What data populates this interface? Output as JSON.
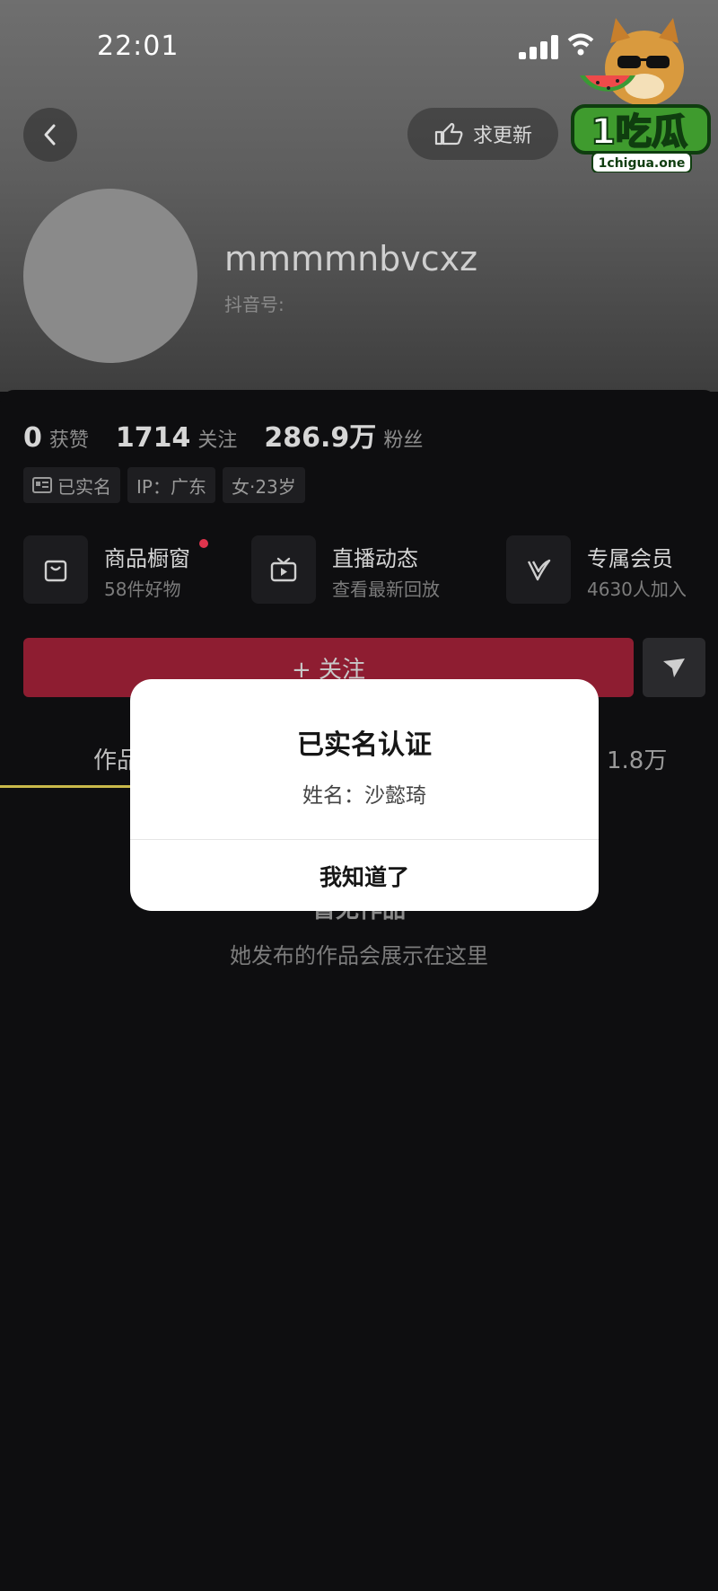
{
  "status_bar": {
    "time": "22:01"
  },
  "header": {
    "request_update_label": "求更新"
  },
  "profile": {
    "username": "mmmmnbvcxz",
    "douyin_id_label": "抖音号:",
    "stats": [
      {
        "value": "0",
        "label": "获赞"
      },
      {
        "value": "1714",
        "label": "关注"
      },
      {
        "value": "286.9万",
        "label": "粉丝"
      }
    ],
    "tags": [
      {
        "icon": "id-card-icon",
        "text": "已实名"
      },
      {
        "icon": null,
        "text": "IP：广东"
      },
      {
        "icon": null,
        "text": "女·23岁"
      }
    ]
  },
  "features": [
    {
      "icon": "shopping-bag-icon",
      "title": "商品橱窗",
      "subtitle": "58件好物",
      "has_dot": true
    },
    {
      "icon": "tv-play-icon",
      "title": "直播动态",
      "subtitle": "查看最新回放"
    },
    {
      "icon": "v-logo-icon",
      "title": "专属会员",
      "subtitle": "4630人加入"
    }
  ],
  "actions": {
    "follow_label": "+ 关注"
  },
  "tabs": {
    "works_label": "作品",
    "count_label": "1.8万"
  },
  "empty_state": {
    "title": "暂无作品",
    "subtitle": "她发布的作品会展示在这里"
  },
  "dialog": {
    "title": "已实名认证",
    "name_line": "姓名：沙懿琦",
    "confirm_label": "我知道了"
  },
  "watermark": {
    "brand": "1吃瓜",
    "domain": "1chigua.one"
  },
  "colors": {
    "follow_button": "#8e1d31",
    "tab_underline": "#c9b94a",
    "notification_dot": "#e0344d"
  }
}
